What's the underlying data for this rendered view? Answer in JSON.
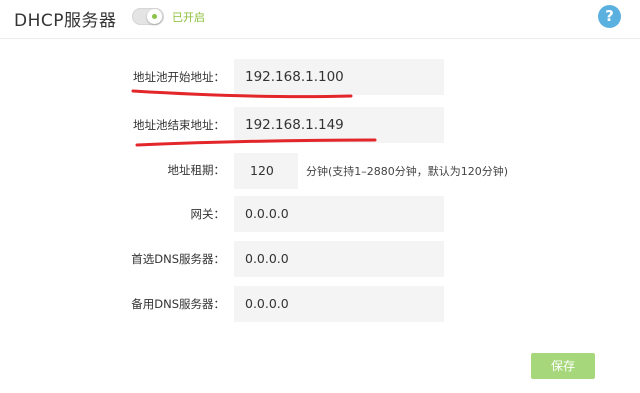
{
  "header": {
    "title": "DHCP服务器",
    "status_text": "已开启",
    "help_label": "?"
  },
  "toggle": {
    "state": "on",
    "accent": "#8bc34a"
  },
  "form": {
    "start_address": {
      "label": "地址池开始地址：",
      "value": "192.168.1.100"
    },
    "end_address": {
      "label": "地址池结束地址：",
      "value": "192.168.1.149"
    },
    "lease": {
      "label": "地址租期：",
      "value": "120",
      "hint": "分钟(支持1–2880分钟，默认为120分钟)"
    },
    "gateway": {
      "label": "网关：",
      "value": "0.0.0.0"
    },
    "primary_dns": {
      "label": "首选DNS服务器：",
      "value": "0.0.0.0"
    },
    "secondary_dns": {
      "label": "备用DNS服务器：",
      "value": "0.0.0.0"
    }
  },
  "actions": {
    "save_label": "保存"
  },
  "colors": {
    "help": "#5ab1e0",
    "save": "#a6d77b",
    "annotation": "#e3262a"
  }
}
